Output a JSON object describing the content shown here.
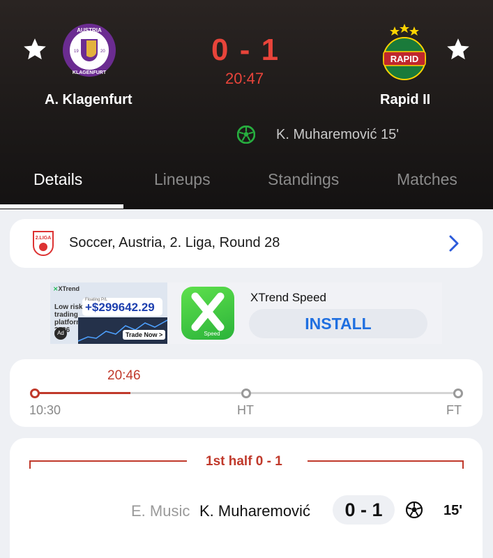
{
  "match": {
    "home_team": "A. Klagenfurt",
    "away_team": "Rapid II",
    "score": "0 - 1",
    "clock": "20:47",
    "home_crest_text_top": "AUSTRIA",
    "home_crest_text_bottom": "KLAGENFURT",
    "home_crest_year_left": "19",
    "home_crest_year_right": "20",
    "away_crest_text": "RAPID",
    "goal_event": "K. Muharemović 15'"
  },
  "tabs": [
    {
      "label": "Details",
      "active": true
    },
    {
      "label": "Lineups",
      "active": false
    },
    {
      "label": "Standings",
      "active": false
    },
    {
      "label": "Matches",
      "active": false
    }
  ],
  "breadcrumb": {
    "text": "Soccer, Austria, 2. Liga, Round 28",
    "league_logo_text": "2.LIGA"
  },
  "ad": {
    "brand": "XTrend",
    "tagline": "Low risk trading platform 2026",
    "balance_label": "Floating P/L",
    "balance": "+$299642.29",
    "trade_button": "Trade Now >",
    "badge": "Ad",
    "app_title": "XTrend Speed",
    "app_sub": "Speed",
    "install_label": "INSTALL"
  },
  "timeline": {
    "current_time": "20:46",
    "start_label": "10:30",
    "ht_label": "HT",
    "ft_label": "FT",
    "progress_fraction": 0.225
  },
  "half_summary": {
    "title": "1st half 0 - 1",
    "events": [
      {
        "assist": "E. Music",
        "scorer": "K. Muharemović",
        "score": "0 - 1",
        "minute": "15'"
      }
    ]
  },
  "colors": {
    "accent_red": "#e8443a",
    "timeline_red": "#c0392b",
    "goal_green": "#27ae3f",
    "install_blue": "#1f6fe0"
  }
}
